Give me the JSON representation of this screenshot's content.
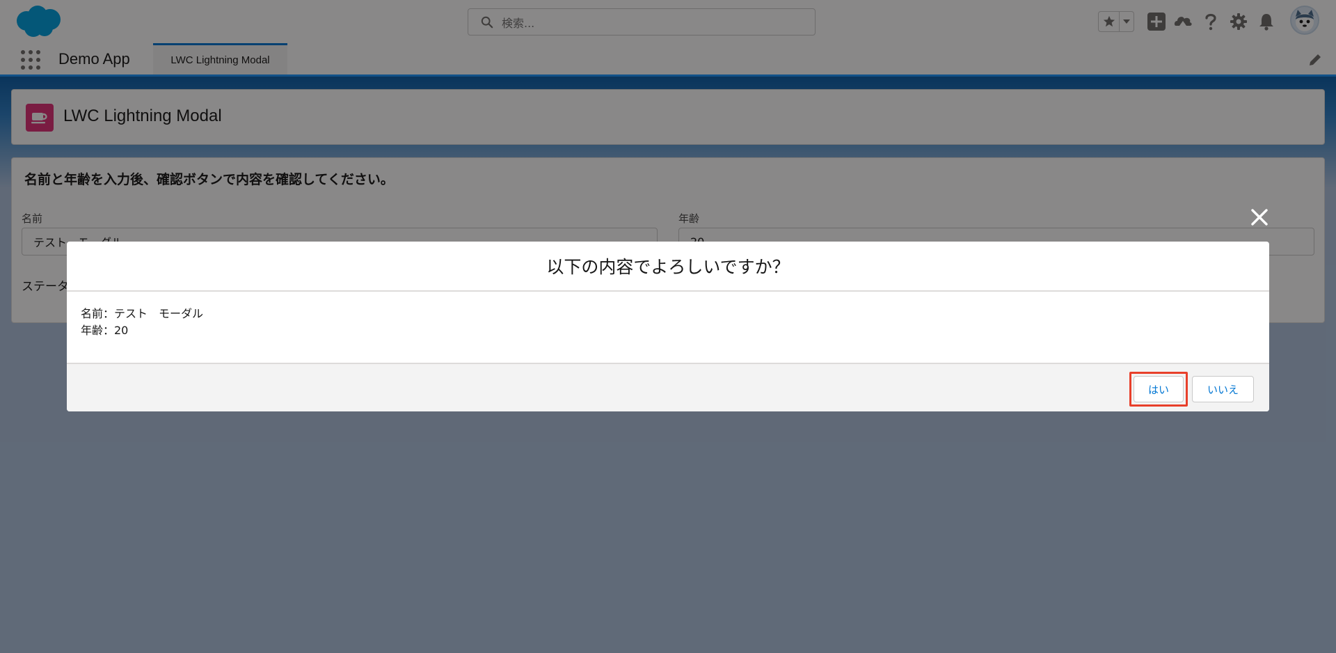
{
  "header": {
    "search_placeholder": "検索...",
    "icons": [
      "cloud-logo-icon",
      "search-icon",
      "star-icon",
      "chevron-down-icon",
      "plus-icon",
      "trailhead-icon",
      "help-icon",
      "gear-icon",
      "bell-icon",
      "avatar"
    ]
  },
  "nav": {
    "app_name": "Demo App",
    "active_tab": "LWC Lightning Modal"
  },
  "page": {
    "title": "LWC Lightning Modal",
    "instruction": "名前と年齢を入力後、確認ボタンで内容を確認してください。",
    "name_label": "名前",
    "name_value": "テスト　モーダル",
    "age_label": "年齢",
    "age_value": "20",
    "status_label": "ステータス"
  },
  "modal": {
    "title": "以下の内容でよろしいですか？",
    "body_lines": [
      "名前：テスト　モーダル",
      "年齢：20"
    ],
    "yes_label": "はい",
    "no_label": "いいえ"
  },
  "colors": {
    "brand": "#0176d3",
    "object_icon": "#e3317a",
    "highlight": "#e8402b",
    "logo": "#00a1e0"
  }
}
